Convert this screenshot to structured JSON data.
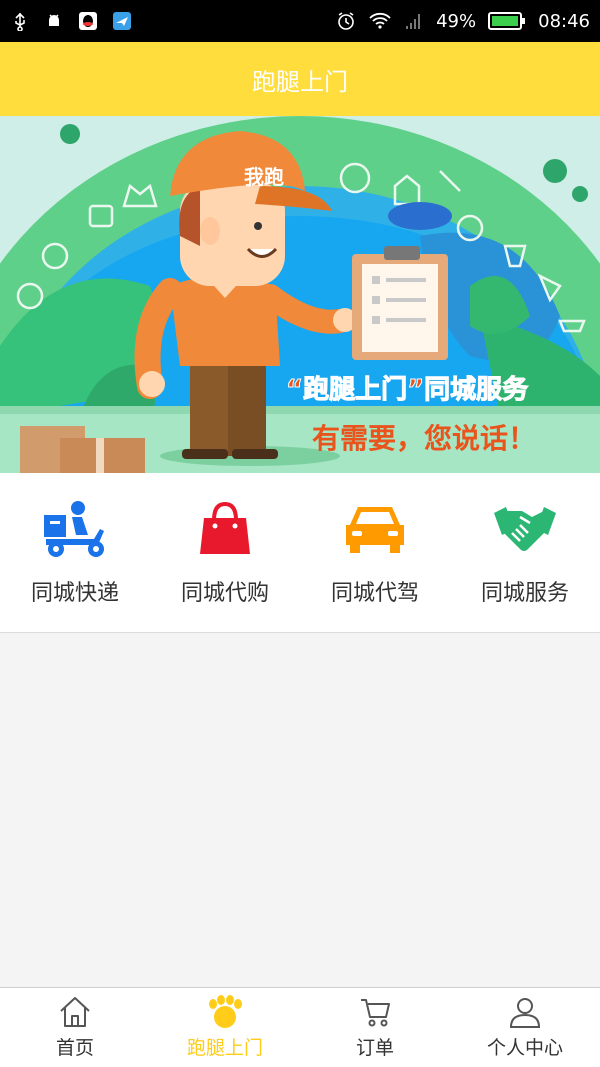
{
  "status_bar": {
    "battery_percent": "49%",
    "time": "08:46",
    "icons": [
      "usb-icon",
      "android-icon",
      "qq-icon",
      "message-app-icon",
      "alarm-icon",
      "wifi-icon",
      "signal-icon",
      "battery-icon"
    ]
  },
  "header": {
    "title": "跑腿上门"
  },
  "banner": {
    "cap_text": "我跑",
    "slogan": "“跑腿上门”同城服务",
    "tagline": "有需要，您说话！"
  },
  "services": [
    {
      "label": "同城快递",
      "icon": "delivery-scooter-icon",
      "color": "#1a73e8"
    },
    {
      "label": "同城代购",
      "icon": "shopping-bag-icon",
      "color": "#e8192c"
    },
    {
      "label": "同城代驾",
      "icon": "car-icon",
      "color": "#ff9a00"
    },
    {
      "label": "同城服务",
      "icon": "handshake-icon",
      "color": "#2bb673"
    }
  ],
  "tabbar": {
    "items": [
      {
        "label": "首页",
        "icon": "home-icon"
      },
      {
        "label": "跑腿上门",
        "icon": "footprint-icon"
      },
      {
        "label": "订单",
        "icon": "cart-icon"
      },
      {
        "label": "个人中心",
        "icon": "person-icon"
      }
    ],
    "active_index": 1,
    "active_color": "#ffcc1a"
  }
}
